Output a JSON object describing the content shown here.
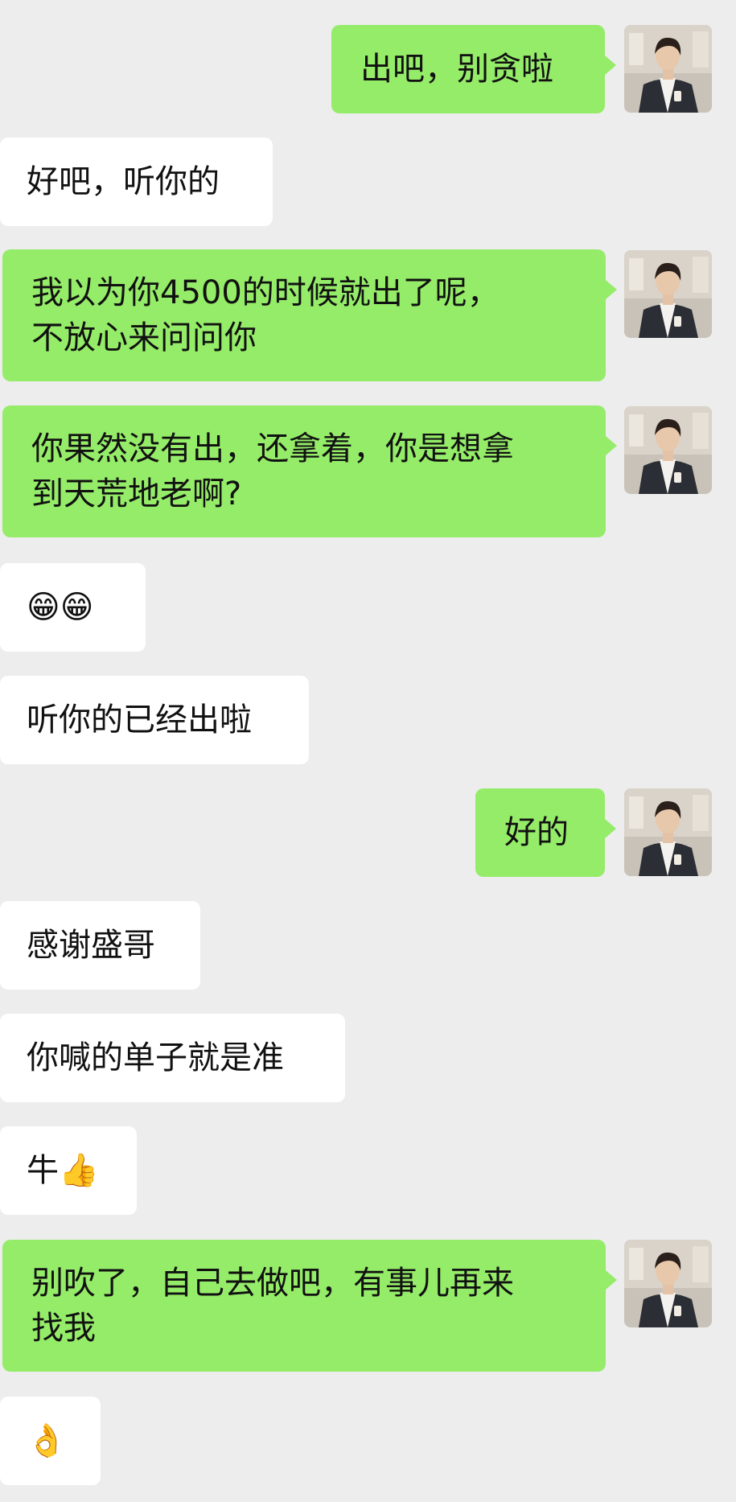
{
  "messages": [
    {
      "from": "me",
      "text": "出吧，别贪啦"
    },
    {
      "from": "other",
      "text": "好吧，听你的"
    },
    {
      "from": "me",
      "lines": [
        "我以为你4500的时候就出了呢，",
        "不放心来问问你"
      ]
    },
    {
      "from": "me",
      "lines": [
        "你果然没有出，还拿着，你是想拿",
        "到天荒地老啊?"
      ]
    },
    {
      "from": "other",
      "text": "😁😁"
    },
    {
      "from": "other",
      "text": "听你的已经出啦"
    },
    {
      "from": "me",
      "text": "好的"
    },
    {
      "from": "other",
      "text": "感谢盛哥"
    },
    {
      "from": "other",
      "text": "你喊的单子就是准"
    },
    {
      "from": "other",
      "text": "牛👍"
    },
    {
      "from": "me",
      "lines": [
        "别吹了，自己去做吧，有事儿再来",
        "找我"
      ]
    },
    {
      "from": "other",
      "text": "👌"
    }
  ],
  "colors": {
    "background": "#ededed",
    "outgoing_bubble": "#95ec69",
    "incoming_bubble": "#ffffff",
    "text": "#111111"
  },
  "icons": {
    "avatar": "user-avatar-photo"
  }
}
